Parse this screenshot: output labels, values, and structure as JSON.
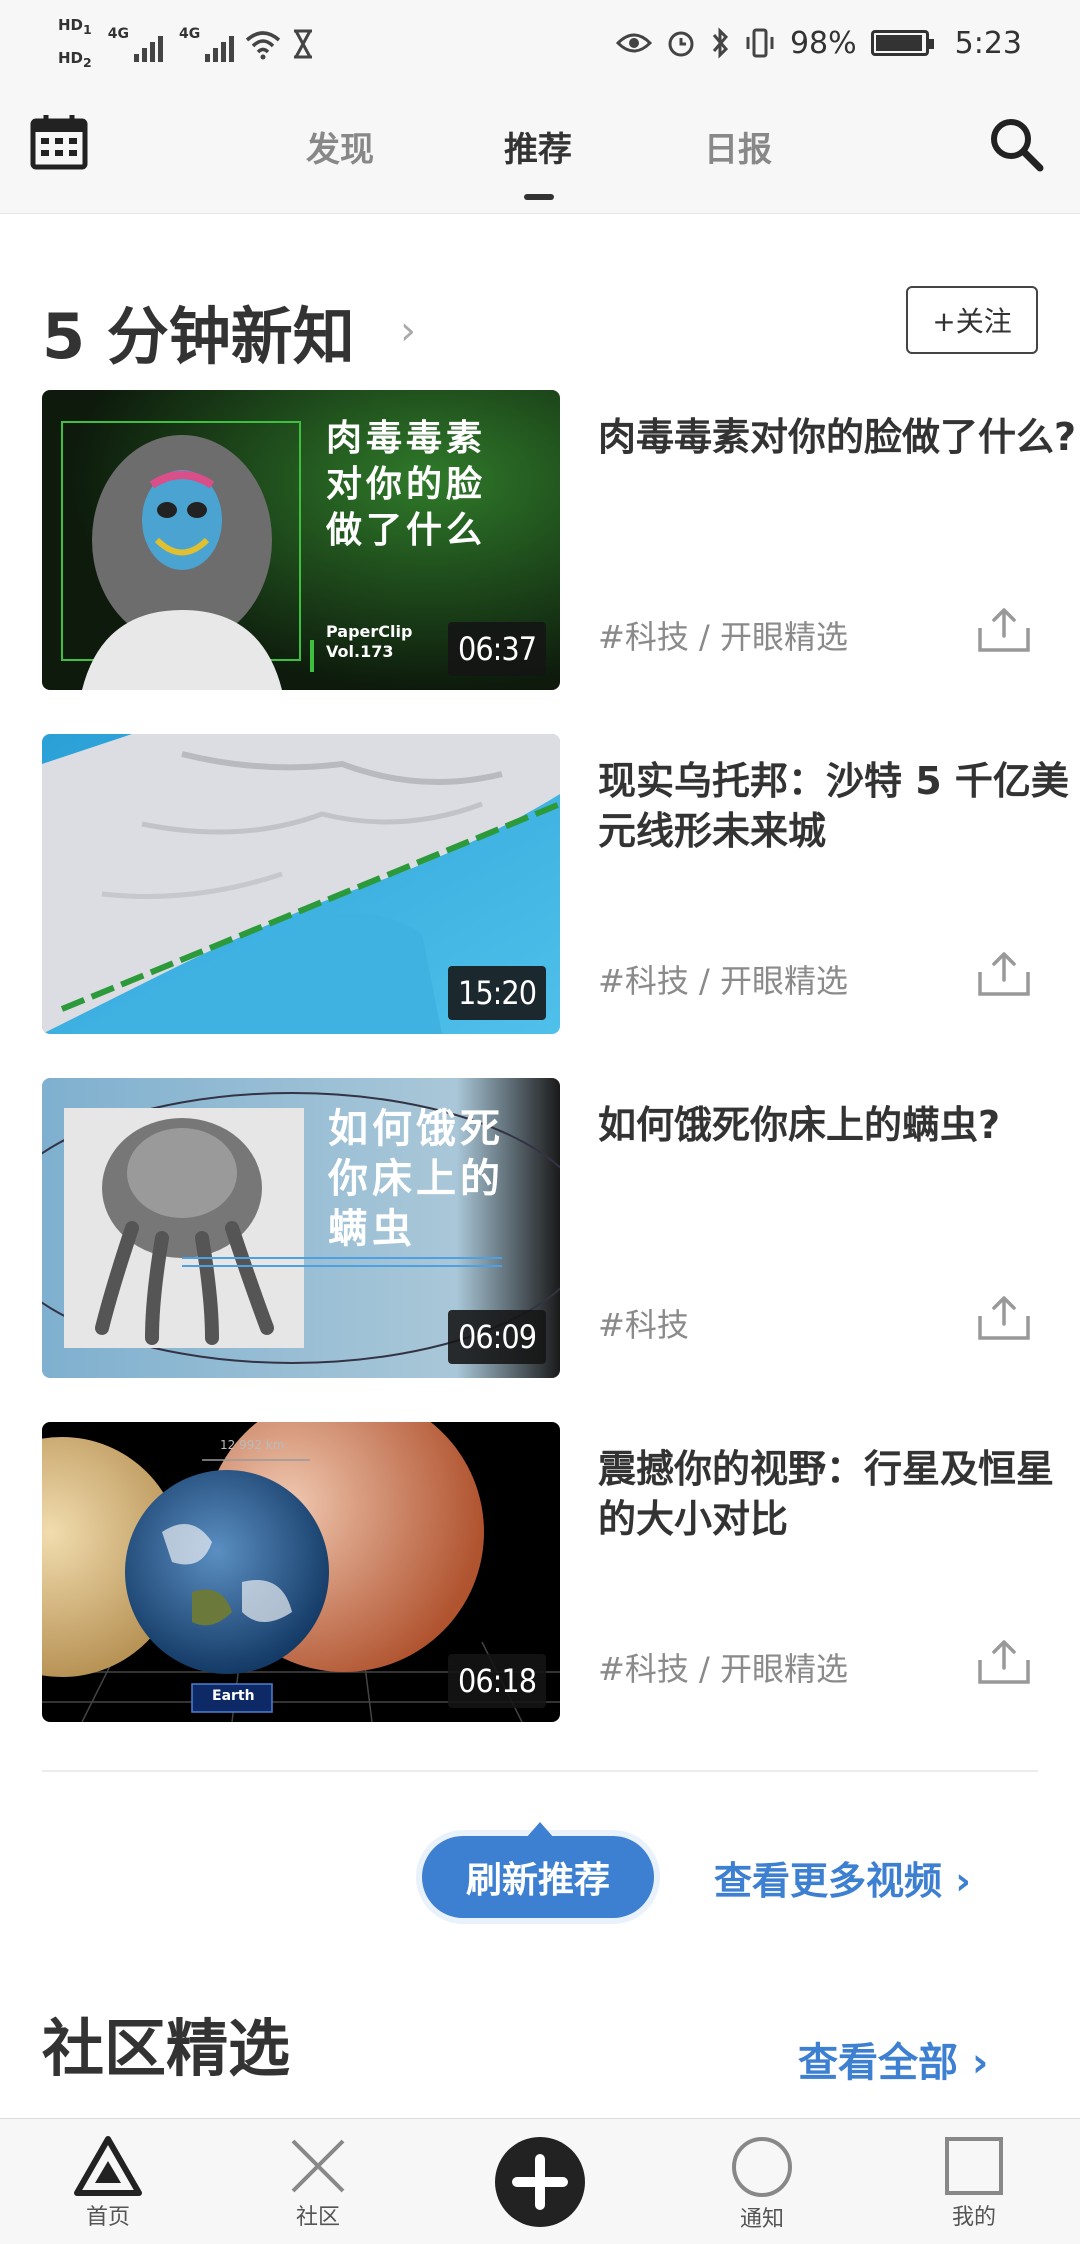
{
  "status_bar": {
    "hd1": "HD",
    "hd1_sub": "1",
    "hd2": "HD",
    "hd2_sub": "2",
    "net1": "4G",
    "net2": "4G",
    "battery_percent": "98%",
    "battery_level": 0.98,
    "time": "5:23"
  },
  "top_nav": {
    "tabs": [
      {
        "label": "发现"
      },
      {
        "label": "推荐",
        "active": true
      },
      {
        "label": "日报"
      }
    ]
  },
  "section": {
    "title": "5 分钟新知",
    "chevron": "›",
    "follow_label": "+关注"
  },
  "videos": [
    {
      "title": "肉毒毒素对你的脸做了什么?",
      "tags": "#科技 / 开眼精选",
      "duration": "06:37",
      "thumb_text": [
        "肉毒毒素",
        "对你的脸",
        "做了什么"
      ],
      "thumb_brand": "PaperClip",
      "thumb_vol": "Vol.173"
    },
    {
      "title": "现实乌托邦：沙特 5 千亿美元线形未来城",
      "tags": "#科技 / 开眼精选",
      "duration": "15:20"
    },
    {
      "title": "如何饿死你床上的螨虫?",
      "tags": "#科技",
      "duration": "06:09",
      "thumb_text": [
        "如何饿死",
        "你床上的",
        "螨虫"
      ]
    },
    {
      "title": "震撼你的视野：行星及恒星的大小对比",
      "tags": "#科技 / 开眼精选",
      "duration": "06:18",
      "thumb_label": "Earth",
      "thumb_measure": "12 992 km"
    }
  ],
  "refresh_label": "刷新推荐",
  "more_videos_label": "查看更多视频 ›",
  "community": {
    "title": "社区精选",
    "view_all_label": "查看全部 ›"
  },
  "bottom_nav": [
    {
      "label": "首页",
      "icon": "triangle-icon"
    },
    {
      "label": "社区",
      "icon": "cross-icon"
    },
    {
      "label": "",
      "icon": "plus-icon"
    },
    {
      "label": "通知",
      "icon": "circle-icon"
    },
    {
      "label": "我的",
      "icon": "square-icon"
    }
  ],
  "colors": {
    "accent": "#3d7fd1",
    "text": "#333333",
    "muted": "#8a8a8a"
  }
}
